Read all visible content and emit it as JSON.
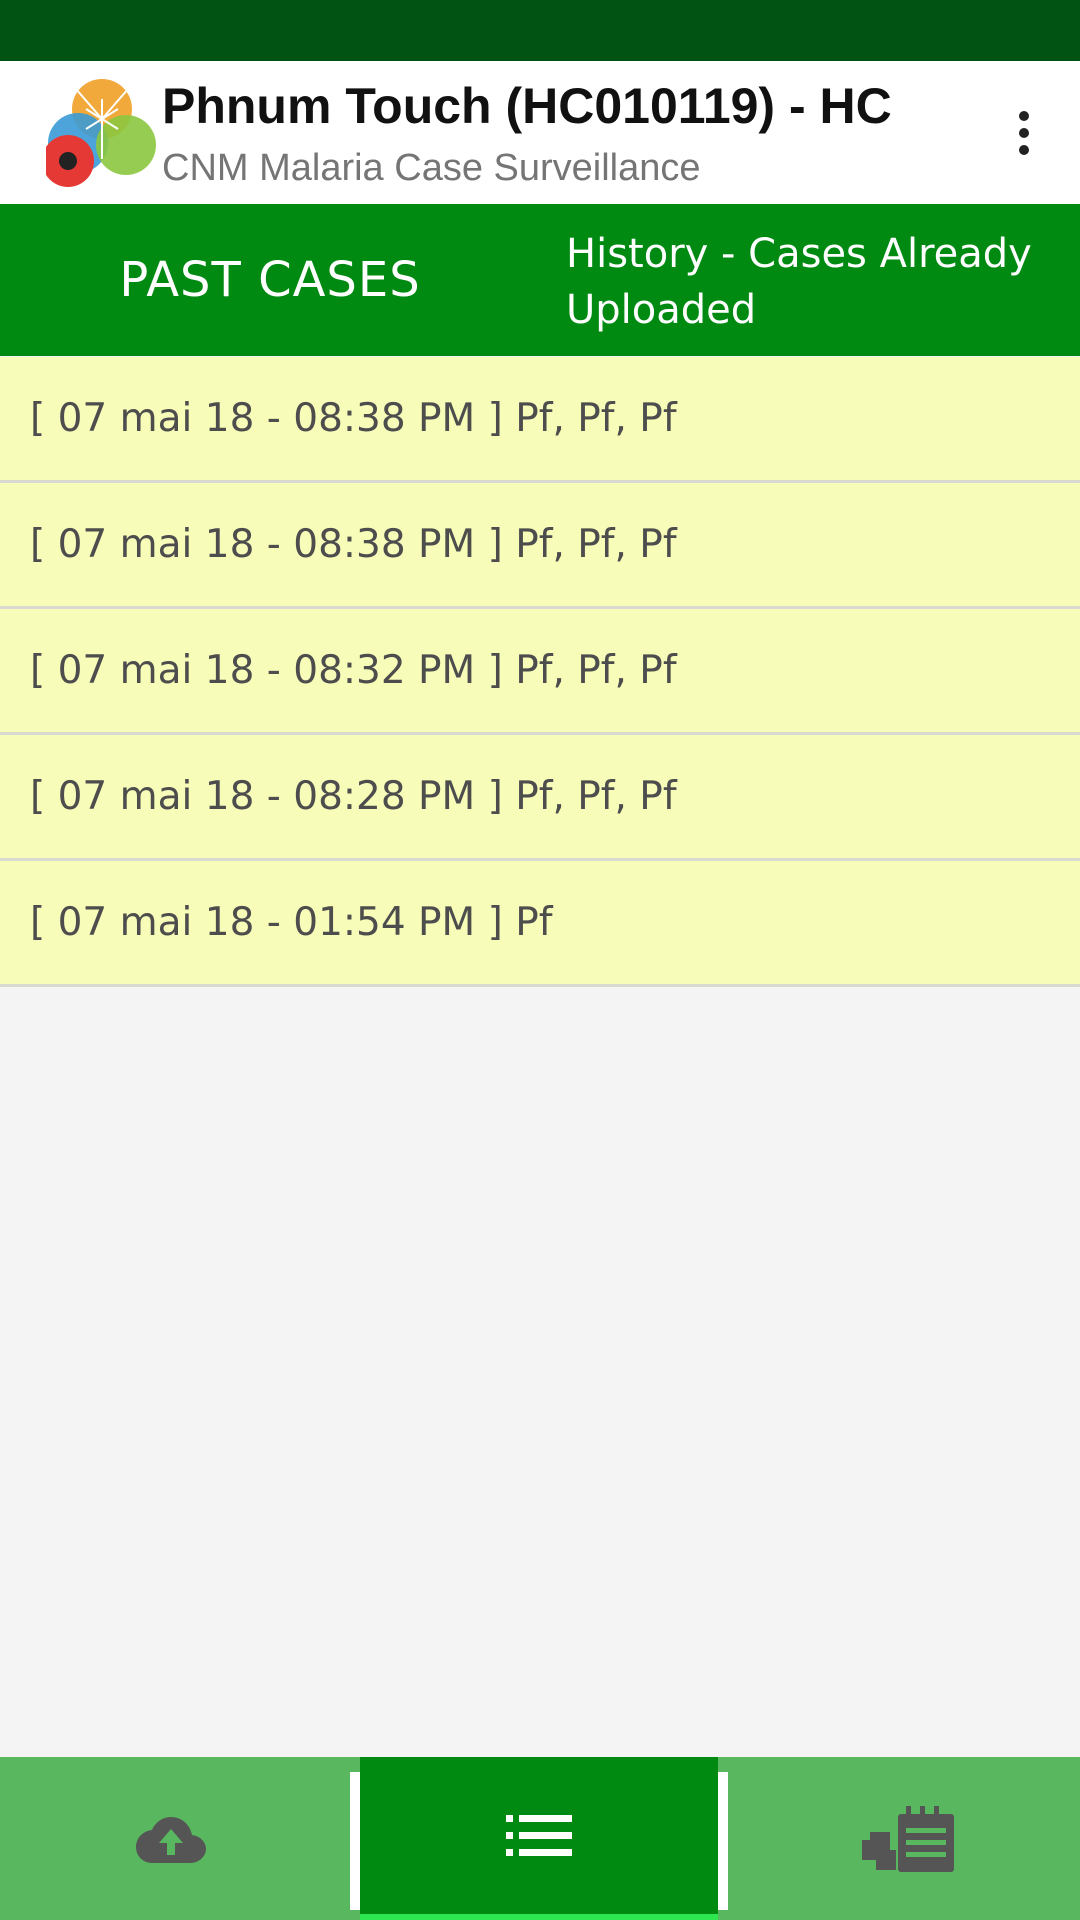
{
  "app_bar": {
    "title": "Phnum Touch (HC010119) - HC",
    "subtitle": "CNM Malaria Case Surveillance"
  },
  "section": {
    "title": "PAST CASES",
    "description": "History - Cases Already Uploaded"
  },
  "cases": [
    {
      "label": "[ 07 mai 18 - 08:38 PM ] Pf, Pf, Pf"
    },
    {
      "label": "[ 07 mai 18 - 08:38 PM ] Pf, Pf, Pf"
    },
    {
      "label": "[ 07 mai 18 - 08:32 PM ] Pf, Pf, Pf"
    },
    {
      "label": "[ 07 mai 18 - 08:28 PM ] Pf, Pf, Pf"
    },
    {
      "label": "[ 07 mai 18 - 01:54 PM ] Pf"
    }
  ],
  "bottom_nav": {
    "items": [
      {
        "icon": "cloud-upload-icon",
        "selected": false
      },
      {
        "icon": "list-icon",
        "selected": true
      },
      {
        "icon": "stock-report-icon",
        "selected": false
      }
    ]
  },
  "colors": {
    "status_bar": "#005312",
    "primary": "#008a12",
    "nav_background": "#58b75f",
    "list_item_background": "#f7fcb8",
    "selected_indicator": "#2ee64f"
  }
}
